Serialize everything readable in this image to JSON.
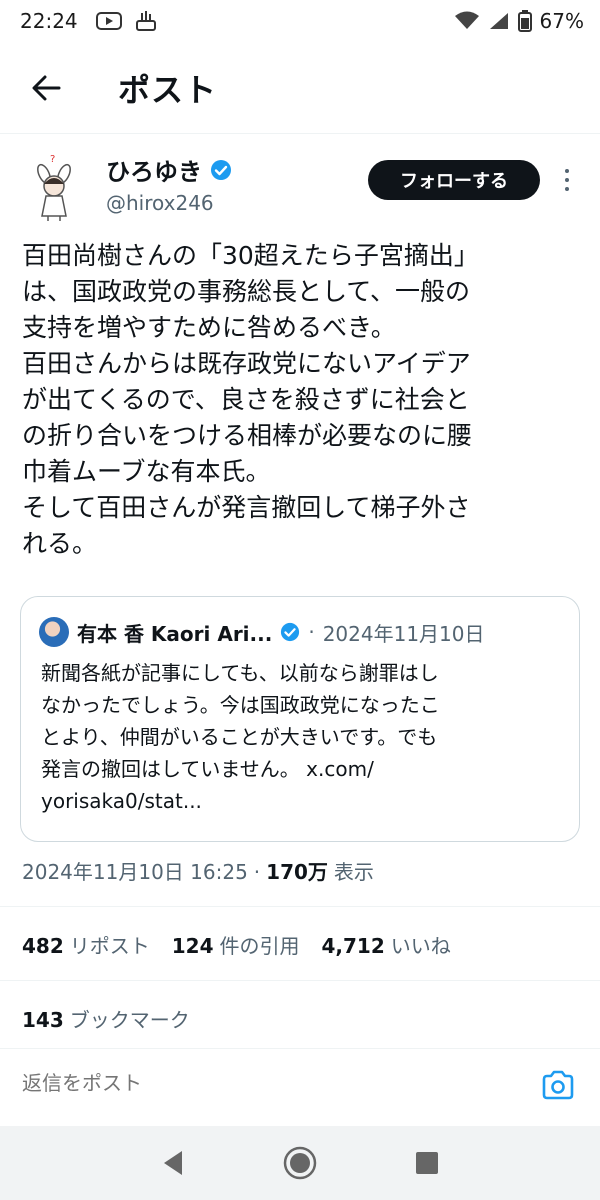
{
  "status_bar": {
    "time": "22:24",
    "battery": "67%"
  },
  "header": {
    "title": "ポスト"
  },
  "author": {
    "display_name": "ひろゆき",
    "handle": "@hirox246",
    "follow_label": "フォローする",
    "verified": true
  },
  "tweet": {
    "text": "百田尚樹さんの「30超えたら子宮摘出」\nは、国政政党の事務総長として、一般の\n支持を増やすために咎めるべき。\n百田さんからは既存政党にないアイデア\nが出てくるので、良さを殺さずに社会と\nの折り合いをつける相棒が必要なのに腰\n巾着ムーブな有本氏。\nそして百田さんが発言撤回して梯子外さ\nれる。"
  },
  "quote": {
    "name": "有本 香 Kaori Ari...",
    "separator": "·",
    "date": "2024年11月10日",
    "text": "新聞各紙が記事にしても、以前なら謝罪はし\nなかったでしょう。今は国政政党になったこ\nとより、仲間がいることが大きいです。でも\n発言の撤回はしていません。 x.com/\nyorisaka0/stat..."
  },
  "meta": {
    "datetime": "2024年11月10日 16:25",
    "separator": "·",
    "views_count": "170万",
    "views_label": "表示"
  },
  "stats": {
    "reposts_count": "482",
    "reposts_label": "リポスト",
    "quotes_count": "124",
    "quotes_label": "件の引用",
    "likes_count": "4,712",
    "likes_label": "いいね",
    "bookmarks_count": "143",
    "bookmarks_label": "ブックマーク"
  },
  "reply": {
    "placeholder": "返信をポスト"
  },
  "icons": {
    "back": "arrow-left-icon",
    "verified": "verified-badge-icon",
    "more": "more-vertical-icon",
    "camera": "camera-icon"
  },
  "colors": {
    "accent": "#1d9bf0",
    "text": "#0f1419",
    "muted": "#536471",
    "button_bg": "#0f1419"
  }
}
